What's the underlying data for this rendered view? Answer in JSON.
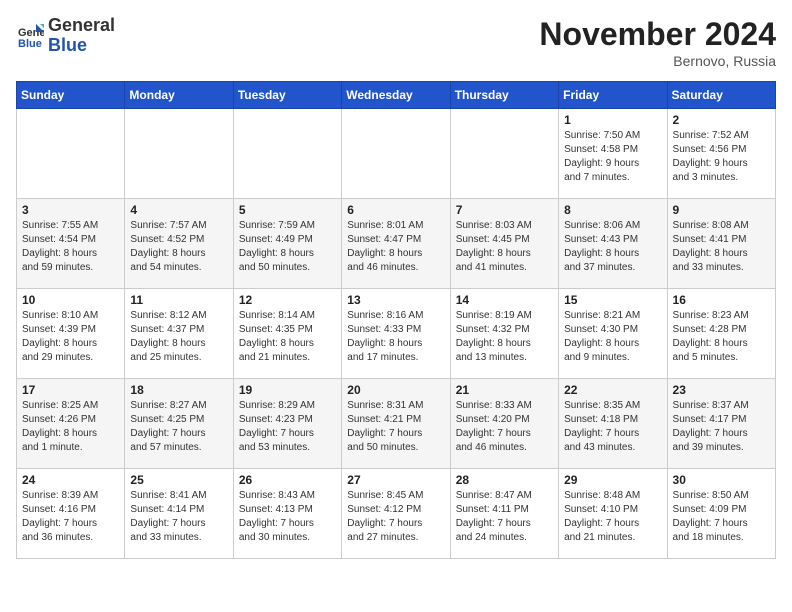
{
  "logo": {
    "general": "General",
    "blue": "Blue"
  },
  "header": {
    "month_year": "November 2024",
    "location": "Bernovo, Russia"
  },
  "weekdays": [
    "Sunday",
    "Monday",
    "Tuesday",
    "Wednesday",
    "Thursday",
    "Friday",
    "Saturday"
  ],
  "weeks": [
    [
      {
        "day": "",
        "info": ""
      },
      {
        "day": "",
        "info": ""
      },
      {
        "day": "",
        "info": ""
      },
      {
        "day": "",
        "info": ""
      },
      {
        "day": "",
        "info": ""
      },
      {
        "day": "1",
        "info": "Sunrise: 7:50 AM\nSunset: 4:58 PM\nDaylight: 9 hours\nand 7 minutes."
      },
      {
        "day": "2",
        "info": "Sunrise: 7:52 AM\nSunset: 4:56 PM\nDaylight: 9 hours\nand 3 minutes."
      }
    ],
    [
      {
        "day": "3",
        "info": "Sunrise: 7:55 AM\nSunset: 4:54 PM\nDaylight: 8 hours\nand 59 minutes."
      },
      {
        "day": "4",
        "info": "Sunrise: 7:57 AM\nSunset: 4:52 PM\nDaylight: 8 hours\nand 54 minutes."
      },
      {
        "day": "5",
        "info": "Sunrise: 7:59 AM\nSunset: 4:49 PM\nDaylight: 8 hours\nand 50 minutes."
      },
      {
        "day": "6",
        "info": "Sunrise: 8:01 AM\nSunset: 4:47 PM\nDaylight: 8 hours\nand 46 minutes."
      },
      {
        "day": "7",
        "info": "Sunrise: 8:03 AM\nSunset: 4:45 PM\nDaylight: 8 hours\nand 41 minutes."
      },
      {
        "day": "8",
        "info": "Sunrise: 8:06 AM\nSunset: 4:43 PM\nDaylight: 8 hours\nand 37 minutes."
      },
      {
        "day": "9",
        "info": "Sunrise: 8:08 AM\nSunset: 4:41 PM\nDaylight: 8 hours\nand 33 minutes."
      }
    ],
    [
      {
        "day": "10",
        "info": "Sunrise: 8:10 AM\nSunset: 4:39 PM\nDaylight: 8 hours\nand 29 minutes."
      },
      {
        "day": "11",
        "info": "Sunrise: 8:12 AM\nSunset: 4:37 PM\nDaylight: 8 hours\nand 25 minutes."
      },
      {
        "day": "12",
        "info": "Sunrise: 8:14 AM\nSunset: 4:35 PM\nDaylight: 8 hours\nand 21 minutes."
      },
      {
        "day": "13",
        "info": "Sunrise: 8:16 AM\nSunset: 4:33 PM\nDaylight: 8 hours\nand 17 minutes."
      },
      {
        "day": "14",
        "info": "Sunrise: 8:19 AM\nSunset: 4:32 PM\nDaylight: 8 hours\nand 13 minutes."
      },
      {
        "day": "15",
        "info": "Sunrise: 8:21 AM\nSunset: 4:30 PM\nDaylight: 8 hours\nand 9 minutes."
      },
      {
        "day": "16",
        "info": "Sunrise: 8:23 AM\nSunset: 4:28 PM\nDaylight: 8 hours\nand 5 minutes."
      }
    ],
    [
      {
        "day": "17",
        "info": "Sunrise: 8:25 AM\nSunset: 4:26 PM\nDaylight: 8 hours\nand 1 minute."
      },
      {
        "day": "18",
        "info": "Sunrise: 8:27 AM\nSunset: 4:25 PM\nDaylight: 7 hours\nand 57 minutes."
      },
      {
        "day": "19",
        "info": "Sunrise: 8:29 AM\nSunset: 4:23 PM\nDaylight: 7 hours\nand 53 minutes."
      },
      {
        "day": "20",
        "info": "Sunrise: 8:31 AM\nSunset: 4:21 PM\nDaylight: 7 hours\nand 50 minutes."
      },
      {
        "day": "21",
        "info": "Sunrise: 8:33 AM\nSunset: 4:20 PM\nDaylight: 7 hours\nand 46 minutes."
      },
      {
        "day": "22",
        "info": "Sunrise: 8:35 AM\nSunset: 4:18 PM\nDaylight: 7 hours\nand 43 minutes."
      },
      {
        "day": "23",
        "info": "Sunrise: 8:37 AM\nSunset: 4:17 PM\nDaylight: 7 hours\nand 39 minutes."
      }
    ],
    [
      {
        "day": "24",
        "info": "Sunrise: 8:39 AM\nSunset: 4:16 PM\nDaylight: 7 hours\nand 36 minutes."
      },
      {
        "day": "25",
        "info": "Sunrise: 8:41 AM\nSunset: 4:14 PM\nDaylight: 7 hours\nand 33 minutes."
      },
      {
        "day": "26",
        "info": "Sunrise: 8:43 AM\nSunset: 4:13 PM\nDaylight: 7 hours\nand 30 minutes."
      },
      {
        "day": "27",
        "info": "Sunrise: 8:45 AM\nSunset: 4:12 PM\nDaylight: 7 hours\nand 27 minutes."
      },
      {
        "day": "28",
        "info": "Sunrise: 8:47 AM\nSunset: 4:11 PM\nDaylight: 7 hours\nand 24 minutes."
      },
      {
        "day": "29",
        "info": "Sunrise: 8:48 AM\nSunset: 4:10 PM\nDaylight: 7 hours\nand 21 minutes."
      },
      {
        "day": "30",
        "info": "Sunrise: 8:50 AM\nSunset: 4:09 PM\nDaylight: 7 hours\nand 18 minutes."
      }
    ]
  ]
}
